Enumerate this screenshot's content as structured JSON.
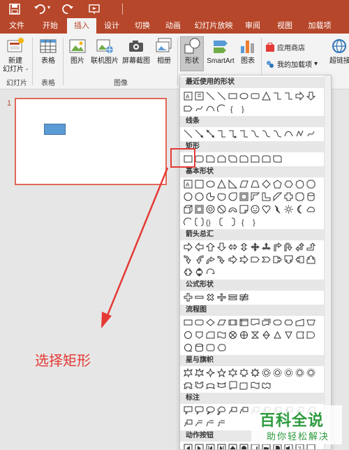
{
  "tabs": [
    "文件",
    "开始",
    "插入",
    "设计",
    "切换",
    "动画",
    "幻灯片放映",
    "审阅",
    "视图",
    "加载项"
  ],
  "active_tab": "插入",
  "ribbon": {
    "new_slide": "新建\n幻灯片",
    "new_slide_line1": "新建",
    "new_slide_line2": "幻灯片 -",
    "table": "表格",
    "picture": "图片",
    "online_picture": "联机图片",
    "screenshot": "屏幕截图",
    "album": "相册",
    "shapes": "形状",
    "smartart": "SmartArt",
    "chart": "图表",
    "app_store": "应用商店",
    "my_addins": "我的加载项",
    "hyperlink": "超链接",
    "group_slides": "幻灯片",
    "group_table": "表格",
    "group_images": "图像"
  },
  "slide_pane": {
    "slide_number": "1"
  },
  "dropdown": {
    "sections": [
      "最近使用的形状",
      "线条",
      "矩形",
      "基本形状",
      "箭头总汇",
      "公式形状",
      "流程图",
      "星与旗帜",
      "标注",
      "动作按钮"
    ]
  },
  "annotation": {
    "text": "选择矩形"
  },
  "watermark": {
    "logo": "百科全说",
    "sub": "助你轻松解决"
  },
  "colors": {
    "accent": "#b7472a",
    "highlight": "#e53935",
    "shape_fill": "#5b9bd5"
  }
}
